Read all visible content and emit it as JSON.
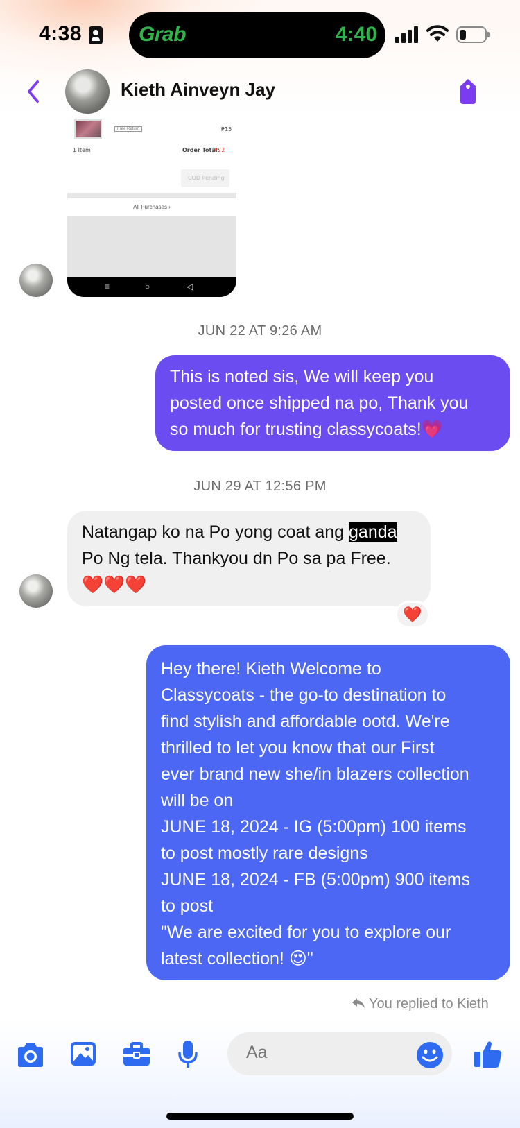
{
  "status_bar": {
    "time": "4:38",
    "live_activity_app": "Grab",
    "live_activity_time": "4:40"
  },
  "header": {
    "contact_name": "Kieth Ainveyn Jay"
  },
  "shared_screenshot": {
    "item_price": "₱15",
    "free_return": "Free Return",
    "item_count": "1 Item",
    "order_total_label": "Order Total:",
    "order_total_value": "₱72",
    "pill_text": "COD Pending",
    "all_purchases": "All Purchases"
  },
  "messages": {
    "timestamp_1": "JUN 22 AT 9:26 AM",
    "out_1": [
      "This is noted sis, We will keep you",
      "posted once shipped na po, Thank you",
      "so much for trusting classycoats!💗"
    ],
    "timestamp_2": "JUN 29 AT 12:56 PM",
    "in_1_pre": "Natangap ko na Po yong coat ang ",
    "in_1_highlight": "ganda",
    "in_1_line2": "Po Ng tela. Thankyou dn Po sa pa Free.",
    "in_1_line3": "❤️❤️❤️",
    "reaction": "❤️",
    "out_2": [
      "Hey there! Kieth Welcome to",
      "Classycoats - the go-to destination to",
      "find stylish and affordable ootd. We're",
      "thrilled to let you know that our First",
      "ever brand new she/in blazers collection",
      "will be on",
      "JUNE 18, 2024 - IG (5:00pm) 100 items",
      "to post mostly rare designs",
      "JUNE 18, 2024 - FB (5:00pm) 900 items",
      "to post",
      "\"We are excited for you to explore our",
      "latest collection! 😍\""
    ],
    "replied_note": "You replied to Kieth"
  },
  "composer": {
    "placeholder": "Aa"
  },
  "colors": {
    "accent": "#7b3cf0",
    "outgoing_purple": "#6b4cf0",
    "outgoing_blue": "#4b67f3",
    "composer_icon": "#2f6bf0",
    "grab_green": "#2fb34a"
  },
  "icons": [
    "id-card-icon",
    "signal-icon",
    "wifi-icon",
    "battery-icon",
    "back-chevron-icon",
    "tag-icon",
    "reply-arrow-icon",
    "camera-icon",
    "gallery-icon",
    "briefcase-icon",
    "microphone-icon",
    "emoji-icon",
    "thumbs-up-icon"
  ]
}
